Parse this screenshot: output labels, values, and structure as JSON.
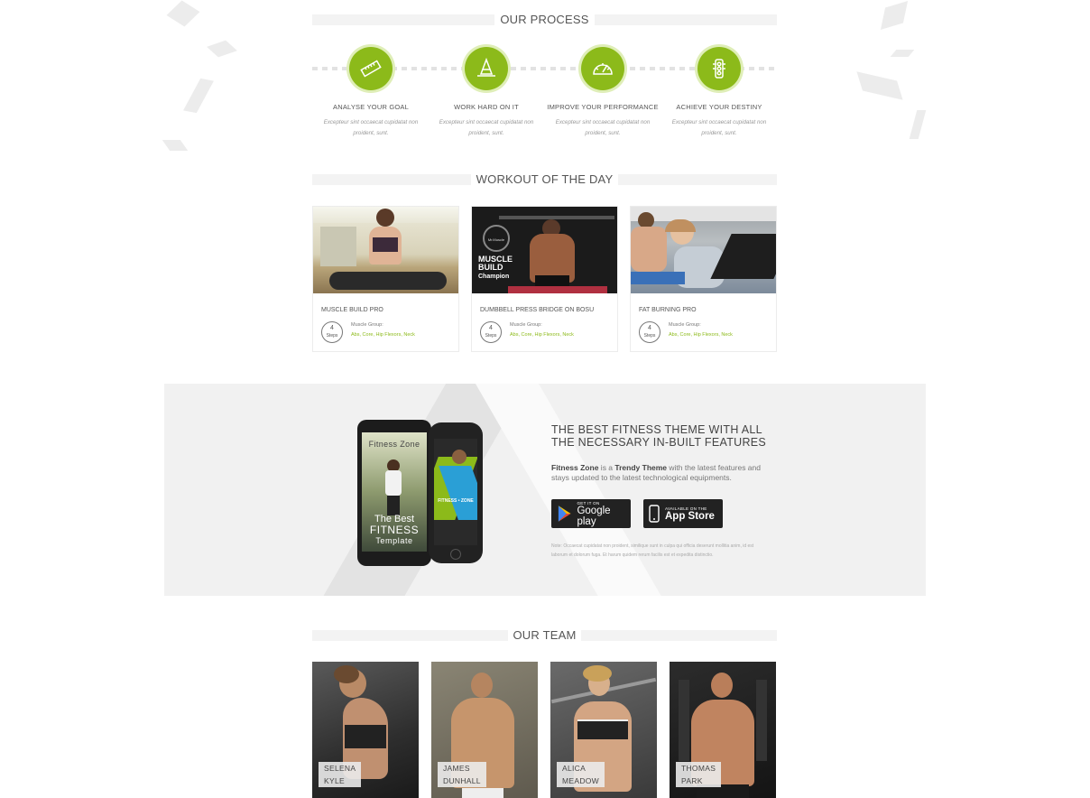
{
  "process": {
    "title": "OUR PROCESS",
    "steps": [
      {
        "title": "ANALYSE YOUR GOAL",
        "desc": "Excepteur sint occaecat cupidatat non proident, sunt.",
        "icon": "ruler-icon"
      },
      {
        "title": "WORK HARD ON IT",
        "desc": "Excepteur sint occaecat cupidatat non proident, sunt.",
        "icon": "cone-icon"
      },
      {
        "title": "IMPROVE YOUR PERFORMANCE",
        "desc": "Excepteur sint occaecat cupidatat non proident, sunt.",
        "icon": "speedometer-icon"
      },
      {
        "title": "ACHIEVE YOUR DESTINY",
        "desc": "Excepteur sint occaecat cupidatat non proident, sunt.",
        "icon": "traffic-light-icon"
      }
    ]
  },
  "workout": {
    "title": "WORKOUT OF THE DAY",
    "cards": [
      {
        "name": "MUSCLE BUILD PRO",
        "steps": "4",
        "steps_label": "Steps",
        "muscle_group_label": "Muscle Group:",
        "muscles": "Abs, Core, Hip Flexors, Neck"
      },
      {
        "name": "DUMBBELL PRESS BRIDGE ON BOSU",
        "steps": "4",
        "steps_label": "Steps",
        "muscle_group_label": "Muscle Group:",
        "muscles": "Abs, Core, Hip Flexors, Neck",
        "image_text_1": "MUSCLE",
        "image_text_2": "BUILD",
        "image_text_3": "Champion",
        "badge": "Mr.Muscle"
      },
      {
        "name": "FAT BURNING PRO",
        "steps": "4",
        "steps_label": "Steps",
        "muscle_group_label": "Muscle Group:",
        "muscles": "Abs, Core, Hip Flexors, Neck"
      }
    ]
  },
  "promo": {
    "title": "THE BEST FITNESS THEME WITH ALL THE NECESSARY IN-BUILT FEATURES",
    "brand": "Fitness Zone",
    "text_mid": " is a ",
    "highlight": "Trendy Theme",
    "text_end": " with the latest features and stays updated to the latest technological equipments.",
    "google_small": "GET IT ON",
    "google_big": "Google play",
    "apple_small": "AVAILABLE ON THE",
    "apple_big": "App Store",
    "note": "Note: Occaecat cupidatat non proident, similique sunt in culpa qui officia deserunt mollitia anim, id est laborum et dolorum fuga. Et harum quidem rerum facilis est et expedita distinctio.",
    "phone_title": "Fitness Zone",
    "phone_line1": "The Best",
    "phone_line2": "FITNESS",
    "phone_line3": "Template",
    "phone2_label": "FITNESS • ZONE",
    "accent": "#8cba1a"
  },
  "team": {
    "title": "OUR TEAM",
    "members": [
      {
        "first": "SELENA",
        "last": "KYLE"
      },
      {
        "first": "JAMES",
        "last": "DUNHALL"
      },
      {
        "first": "ALICA",
        "last": "MEADOW"
      },
      {
        "first": "THOMAS",
        "last": "PARK"
      }
    ]
  }
}
